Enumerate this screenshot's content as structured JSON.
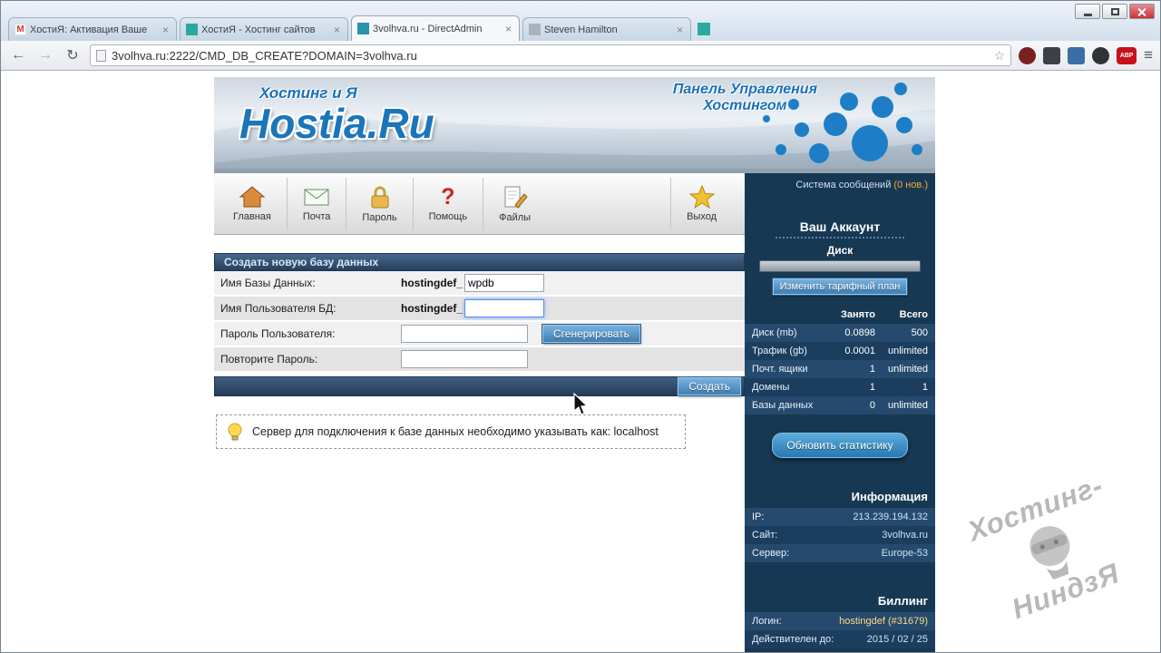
{
  "browser": {
    "tabs": [
      {
        "title": "ХостиЯ: Активация Ваше",
        "favicon_glyph": "M"
      },
      {
        "title": "ХостиЯ - Хостинг сайтов",
        "favicon_glyph": ""
      },
      {
        "title": "3volhva.ru - DirectAdmin",
        "favicon_glyph": ""
      },
      {
        "title": "Steven Hamilton",
        "favicon_glyph": ""
      }
    ],
    "url": "3volhva.ru:2222/CMD_DB_CREATE?DOMAIN=3volhva.ru",
    "icons": {
      "back": "←",
      "forward": "→",
      "refresh": "↻",
      "star": "☆",
      "menu": "≡",
      "close": "×",
      "abp": "ABP"
    }
  },
  "header": {
    "tagline": "Хостинг и Я",
    "logo": "Hostia.Ru",
    "panel_line1": "Панель Управления",
    "panel_line2": "Хостингом"
  },
  "nav": {
    "items": [
      {
        "label": "Главная"
      },
      {
        "label": "Почта"
      },
      {
        "label": "Пароль"
      },
      {
        "label": "Помощь"
      },
      {
        "label": "Файлы"
      },
      {
        "label": "Выход"
      }
    ],
    "help_glyph": "?"
  },
  "form": {
    "title": "Создать новую базу данных",
    "rows": [
      {
        "label": "Имя Базы Данных:",
        "prefix": "hostingdef_",
        "value": "wpdb"
      },
      {
        "label": "Имя Пользователя БД:",
        "prefix": "hostingdef_",
        "value": ""
      },
      {
        "label": "Пароль Пользователя:",
        "value": "",
        "button": "Сгенерировать"
      },
      {
        "label": "Повторите Пароль:",
        "value": ""
      }
    ],
    "submit_button": "Создать",
    "hint": "Сервер для подключения к базе данных необходимо указывать как: localhost"
  },
  "sidebar": {
    "messages_prefix": "Система сообщений ",
    "messages_count": "(0 нов.)",
    "account_title": "Ваш Аккаунт",
    "disk_label": "Диск",
    "change_plan_button": "Изменить тарифный план",
    "usage_headers": [
      "Занято",
      "Всего"
    ],
    "usage_rows": [
      {
        "label": "Диск (mb)",
        "used": "0.0898",
        "total": "500"
      },
      {
        "label": "Трафик (gb)",
        "used": "0.0001",
        "total": "unlimited"
      },
      {
        "label": "Почт. ящики",
        "used": "1",
        "total": "unlimited"
      },
      {
        "label": "Домены",
        "used": "1",
        "total": "1"
      },
      {
        "label": "Базы данных",
        "used": "0",
        "total": "unlimited"
      }
    ],
    "refresh_button": "Обновить статистику",
    "info_title": "Информация",
    "info_rows": [
      {
        "label": "IP:",
        "value": "213.239.194.132"
      },
      {
        "label": "Сайт:",
        "value": "3volhva.ru"
      },
      {
        "label": "Сервер:",
        "value": "Europe-53"
      }
    ],
    "billing_title": "Биллинг",
    "billing_rows": [
      {
        "label": "Логин:",
        "value": "hostingdef (#31679)"
      },
      {
        "label": "Действителен до:",
        "value": "2015 / 02 / 25"
      }
    ]
  },
  "watermark": {
    "line1": "Хостинг-",
    "line2": "НиндзЯ"
  }
}
